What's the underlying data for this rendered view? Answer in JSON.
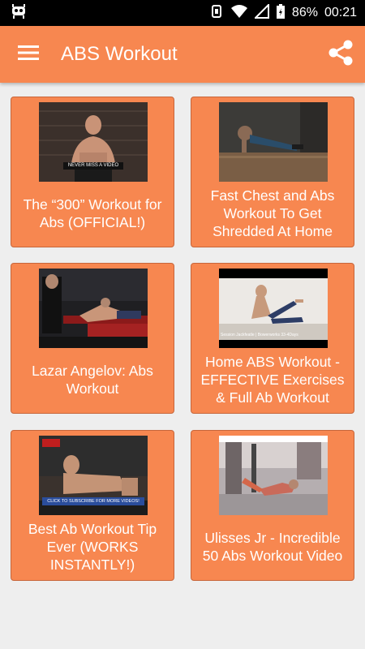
{
  "status_bar": {
    "battery": "86%",
    "time": "00:21"
  },
  "app_bar": {
    "title": "ABS Workout"
  },
  "videos": [
    {
      "title": "The “300” Workout for Abs (OFFICIAL!)",
      "thumb_caption": "NEVER MISS A VIDEO"
    },
    {
      "title": "Fast Chest and Abs Workout To Get Shredded At Home"
    },
    {
      "title": "Lazar Angelov: Abs Workout"
    },
    {
      "title": "Home ABS Workout - EFFECTIVE Exercises & Full Ab Workout",
      "thumb_caption": "Session Jackfeatle | Bowerworks 33-4Days"
    },
    {
      "title": "Best Ab Workout Tip Ever (WORKS INSTANTLY!)",
      "thumb_caption": "CLICK TO SUBSCRIBE FOR MORE VIDEOS!"
    },
    {
      "title": "Ulisses Jr - Incredible 50 Abs Workout Video"
    }
  ],
  "colors": {
    "primary": "#f78750",
    "card_border": "#c7663b",
    "background": "#eeeeee"
  }
}
